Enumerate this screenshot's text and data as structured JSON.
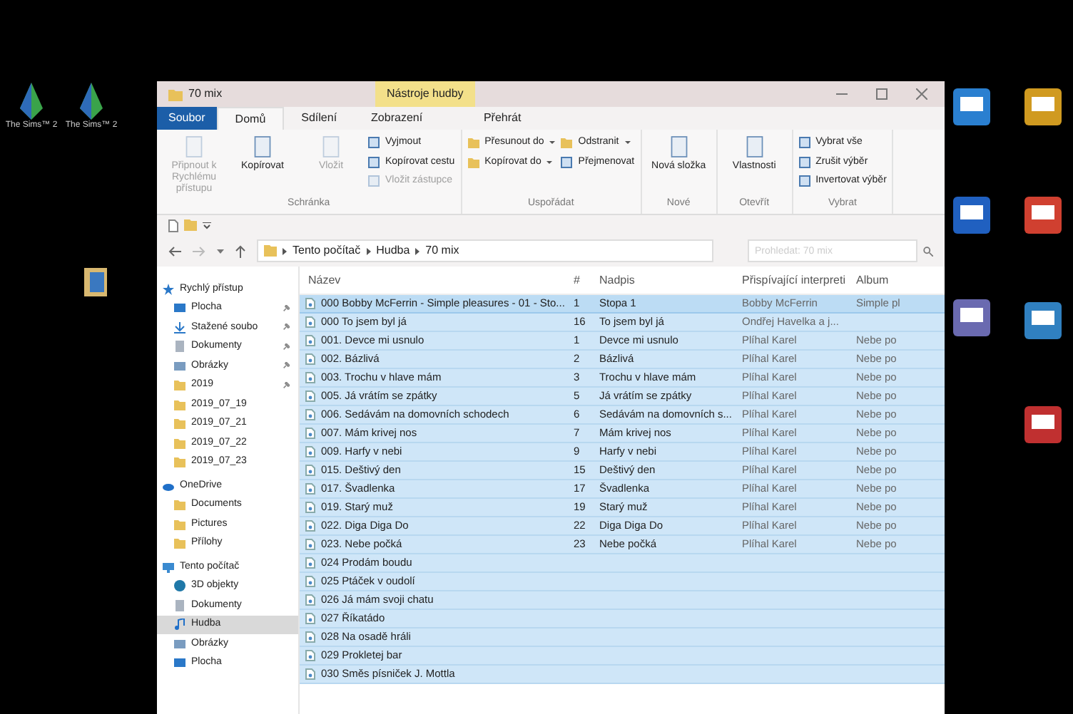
{
  "desktop": {
    "left_icons": [
      {
        "label": "The Sims™ 2"
      },
      {
        "label": "The Sims™ 2"
      }
    ]
  },
  "window": {
    "title": "70 mix",
    "context_tab": "Nástroje hudby"
  },
  "tabs": [
    {
      "label": "Soubor",
      "kind": "file",
      "selected": false
    },
    {
      "label": "Domů",
      "kind": "tab",
      "selected": true
    },
    {
      "label": "Sdílení",
      "kind": "tab",
      "selected": false
    },
    {
      "label": "Zobrazení",
      "kind": "tab",
      "selected": false
    },
    {
      "label": "Přehrát",
      "kind": "tab",
      "selected": false
    }
  ],
  "ribbon": {
    "groups": [
      {
        "label": "Schránka",
        "buttons": [
          {
            "label": "Připnout k Rychlému přístupu",
            "kind": "large",
            "disabled": true
          },
          {
            "label": "Kopírovat",
            "kind": "large",
            "disabled": false
          },
          {
            "label": "Vložit",
            "kind": "large",
            "disabled": true
          },
          {
            "label": "Vyjmout",
            "kind": "small",
            "disabled": false
          },
          {
            "label": "Kopírovat cestu",
            "kind": "small",
            "disabled": false
          },
          {
            "label": "Vložit zástupce",
            "kind": "small",
            "disabled": true
          }
        ]
      },
      {
        "label": "Uspořádat",
        "buttons": [
          {
            "label": "Přesunout do",
            "kind": "menu",
            "disabled": false
          },
          {
            "label": "Kopírovat do",
            "kind": "menu",
            "disabled": false
          },
          {
            "label": "Odstranit",
            "kind": "menu",
            "disabled": false
          },
          {
            "label": "Přejmenovat",
            "kind": "small",
            "disabled": false
          }
        ]
      },
      {
        "label": "Nové",
        "buttons": [
          {
            "label": "Nová složka",
            "kind": "large",
            "disabled": false
          }
        ]
      },
      {
        "label": "Otevřít",
        "buttons": [
          {
            "label": "Vlastnosti",
            "kind": "large",
            "disabled": false
          }
        ]
      },
      {
        "label": "Vybrat",
        "buttons": [
          {
            "label": "Vybrat vše",
            "kind": "small",
            "disabled": false
          },
          {
            "label": "Zrušit výběr",
            "kind": "small",
            "disabled": false
          },
          {
            "label": "Invertovat výběr",
            "kind": "small",
            "disabled": false
          }
        ]
      }
    ]
  },
  "address": {
    "path": [
      "Tento počítač",
      "Hudba",
      "70 mix"
    ]
  },
  "search": {
    "placeholder": "Prohledat: 70 mix"
  },
  "sidebar": {
    "items": [
      {
        "label": "Rychlý přístup",
        "kind": "star",
        "pinned": false,
        "selected": false,
        "children": [
          {
            "label": "Plocha",
            "kind": "desktop",
            "pinned": true,
            "selected": false
          },
          {
            "label": "Stažené soubo",
            "kind": "download",
            "pinned": true,
            "selected": false
          },
          {
            "label": "Dokumenty",
            "kind": "document",
            "pinned": true,
            "selected": false
          },
          {
            "label": "Obrázky",
            "kind": "picture",
            "pinned": true,
            "selected": false
          },
          {
            "label": "2019",
            "kind": "folder",
            "pinned": true,
            "selected": false
          },
          {
            "label": "2019_07_19",
            "kind": "folder",
            "pinned": false,
            "selected": false
          },
          {
            "label": "2019_07_21",
            "kind": "folder",
            "pinned": false,
            "selected": false
          },
          {
            "label": "2019_07_22",
            "kind": "folder",
            "pinned": false,
            "selected": false
          },
          {
            "label": "2019_07_23",
            "kind": "folder",
            "pinned": false,
            "selected": false
          }
        ]
      },
      {
        "label": "OneDrive",
        "kind": "cloud",
        "pinned": false,
        "selected": false,
        "children": [
          {
            "label": "Documents",
            "kind": "folder",
            "pinned": false,
            "selected": false
          },
          {
            "label": "Pictures",
            "kind": "folder",
            "pinned": false,
            "selected": false
          },
          {
            "label": "Přílohy",
            "kind": "folder",
            "pinned": false,
            "selected": false
          }
        ]
      },
      {
        "label": "Tento počítač",
        "kind": "computer",
        "pinned": false,
        "selected": false,
        "children": [
          {
            "label": "3D objekty",
            "kind": "cube",
            "pinned": false,
            "selected": false
          },
          {
            "label": "Dokumenty",
            "kind": "document",
            "pinned": false,
            "selected": false
          },
          {
            "label": "Hudba",
            "kind": "music",
            "pinned": false,
            "selected": true
          },
          {
            "label": "Obrázky",
            "kind": "picture",
            "pinned": false,
            "selected": false
          },
          {
            "label": "Plocha",
            "kind": "desktop",
            "pinned": false,
            "selected": false
          }
        ]
      }
    ]
  },
  "table": {
    "columns": [
      "Název",
      "#",
      "Nadpis",
      "Přispívající interpreti",
      "Album"
    ],
    "rows": [
      {
        "name": "000 Bobby McFerrin - Simple pleasures - 01 - Sto...",
        "number": "1",
        "title": "Stopa 1",
        "artist": "Bobby McFerrin",
        "album": "Simple pl",
        "selected": true
      },
      {
        "name": "000 To jsem byl já",
        "number": "16",
        "title": "To jsem byl já",
        "artist": "Ondřej Havelka a j...",
        "selected": true
      },
      {
        "name": "001. Devce mi usnulo",
        "number": "1",
        "title": "Devce mi usnulo",
        "artist": "Plíhal Karel",
        "album": "Nebe po",
        "selected": true
      },
      {
        "name": "002. Bázlivá",
        "number": "2",
        "title": "Bázlivá",
        "artist": "Plíhal Karel",
        "album": "Nebe po",
        "selected": true
      },
      {
        "name": "003. Trochu v hlave mám",
        "number": "3",
        "title": "Trochu v hlave mám",
        "artist": "Plíhal Karel",
        "album": "Nebe po",
        "selected": true
      },
      {
        "name": "005. Já vrátím se zpátky",
        "number": "5",
        "title": "Já vrátím se zpátky",
        "artist": "Plíhal Karel",
        "album": "Nebe po",
        "selected": true
      },
      {
        "name": "006. Sedávám na domovních schodech",
        "number": "6",
        "title": "Sedávám na domovních s...",
        "artist": "Plíhal Karel",
        "album": "Nebe po",
        "selected": true
      },
      {
        "name": "007. Mám krivej nos",
        "number": "7",
        "title": "Mám krivej nos",
        "artist": "Plíhal Karel",
        "album": "Nebe po",
        "selected": true
      },
      {
        "name": "009. Harfy v nebi",
        "number": "9",
        "title": "Harfy v nebi",
        "artist": "Plíhal Karel",
        "album": "Nebe po",
        "selected": true
      },
      {
        "name": "015. Deštivý den",
        "number": "15",
        "title": "Deštivý den",
        "artist": "Plíhal Karel",
        "album": "Nebe po",
        "selected": true
      },
      {
        "name": "017. Švadlenka",
        "number": "17",
        "title": "Švadlenka",
        "artist": "Plíhal Karel",
        "album": "Nebe po",
        "selected": true
      },
      {
        "name": "019. Starý muž",
        "number": "19",
        "title": "Starý muž",
        "artist": "Plíhal Karel",
        "album": "Nebe po",
        "selected": true
      },
      {
        "name": "022. Diga Diga Do",
        "number": "22",
        "title": "Diga Diga Do",
        "artist": "Plíhal Karel",
        "album": "Nebe po",
        "selected": true
      },
      {
        "name": "023. Nebe počká",
        "number": "23",
        "title": "Nebe počká",
        "artist": "Plíhal Karel",
        "album": "Nebe po",
        "selected": true
      },
      {
        "name": "024 Prodám boudu",
        "selected": true
      },
      {
        "name": "025 Ptáček v oudolí",
        "selected": true
      },
      {
        "name": "026 Já mám svoji chatu",
        "selected": true
      },
      {
        "name": "027 Říkatádo",
        "selected": true
      },
      {
        "name": "028 Na osadě hráli",
        "selected": true
      },
      {
        "name": "029 Prokletej bar",
        "selected": true
      },
      {
        "name": "030 Směs písniček J. Mottla",
        "selected": true
      }
    ]
  }
}
